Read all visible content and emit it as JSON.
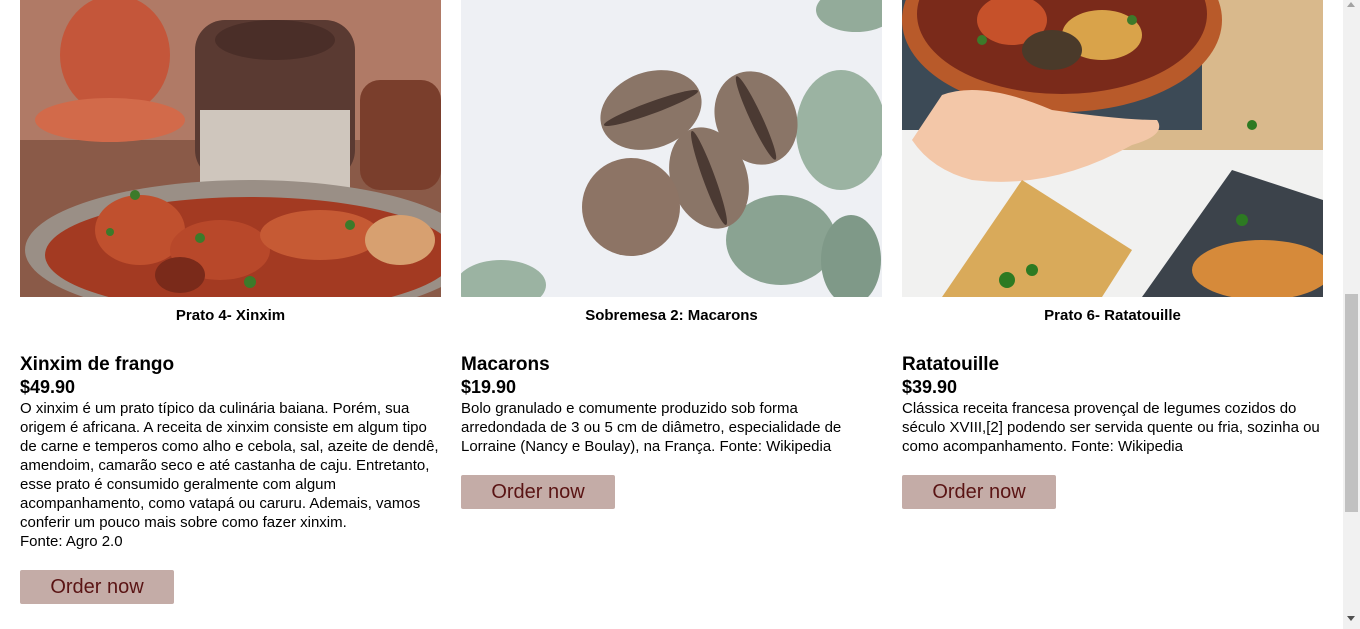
{
  "products": [
    {
      "image": "xinxim-chicken-photo",
      "caption": "Prato 4- Xinxim",
      "name": "Xinxim de frango",
      "price": "$49.90",
      "description": "O xinxim é um prato típico da culinária baiana. Porém, sua origem é africana. A receita de xinxim consiste em algum tipo de carne e temperos como alho e cebola, sal, azeite de dendê, amendoim, camarão seco e até castanha de caju. Entretanto, esse prato é consumido geralmente com algum acompanhamento, como vatapá ou caruru. Ademais, vamos conferir um pouco mais sobre como fazer xinxim.\nFonte: Agro 2.0",
      "button": "Order now"
    },
    {
      "image": "macarons-photo",
      "caption": "Sobremesa 2: Macarons",
      "name": "Macarons",
      "price": "$19.90",
      "description": "Bolo granulado e comumente produzido sob forma arredondada de 3 ou 5 cm de diâmetro, especialidade de Lorraine (Nancy e Boulay), na França. Fonte: Wikipedia",
      "button": "Order now"
    },
    {
      "image": "ratatouille-photo",
      "caption": "Prato 6- Ratatouille",
      "name": "Ratatouille",
      "price": "$39.90",
      "description": "Clássica receita francesa provençal de legumes cozidos do século XVIII,[2] podendo ser servida quente ou fria, sozinha ou como acompanhamento. Fonte: Wikipedia",
      "button": "Order now"
    }
  ],
  "colors": {
    "button_bg": "#c4aca7",
    "button_text": "#5a1414"
  }
}
